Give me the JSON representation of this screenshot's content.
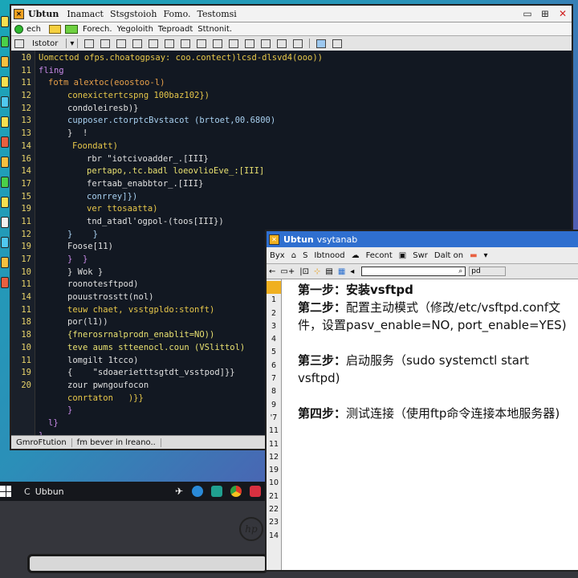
{
  "colors": {
    "code_bg": "#121822",
    "gutter_yellow": "#e8d36a",
    "notepad_title": "#2f6fcf",
    "accent_orange": "#f0b020"
  },
  "editor": {
    "app_name": "Ubtun",
    "title_menus": [
      "Inamact",
      "Stsgstoioh",
      "Fomo.",
      "Testomsi"
    ],
    "menubar": [
      "ech",
      "Forech.",
      "Yegoloith",
      "Teproadt",
      "Sttnonit."
    ],
    "toolbar_label": "Istotor",
    "line_numbers": [
      "10",
      "11",
      "11",
      "12",
      "12",
      "13",
      "13",
      "14",
      "16",
      "14",
      "17",
      "15",
      "19",
      "11",
      "12",
      "19",
      "17",
      "10",
      "11",
      "14",
      "11",
      "18",
      "18",
      "10",
      "11",
      "19",
      "20"
    ],
    "code_lines": [
      {
        "indent": 0,
        "color": "#e8c84a",
        "text": "Uomcctod ofps.choatogpsay: coo.contect)lcsd-dlsvd4(ooo))"
      },
      {
        "indent": 0,
        "color": "#c98ae8",
        "text": "fling"
      },
      {
        "indent": 2,
        "color": "#e8a04a",
        "text": "fotm alextoc(eoostoo-l)"
      },
      {
        "indent": 6,
        "color": "#e8c84a",
        "text": "conexictertcspng 100baz102})"
      },
      {
        "indent": 6,
        "color": "#e0e0e0",
        "text": "condoleiresb)}"
      },
      {
        "indent": 6,
        "color": "#a8d0f0",
        "text": "cupposer.ctorptcBvstacot (brtoet,00.6800)"
      },
      {
        "indent": 6,
        "color": "#e0e0e0",
        "text": "}  !"
      },
      {
        "indent": 7,
        "color": "#e8c84a",
        "text": "Foondatt)"
      },
      {
        "indent": 10,
        "color": "#e0e0e0",
        "text": "rbr \"iotcivoadder_.[III}"
      },
      {
        "indent": 10,
        "color": "#e8e070",
        "text": "pertapo,.tc.badl loeovlioEve_:[III]"
      },
      {
        "indent": 10,
        "color": "#e0e0e0",
        "text": "fertaab_enabbtor_.[III}"
      },
      {
        "indent": 10,
        "color": "#a8d0f0",
        "text": "conrrey]})"
      },
      {
        "indent": 10,
        "color": "#e8c84a",
        "text": "ver ttosaatta)"
      },
      {
        "indent": 10,
        "color": "#e0e0e0",
        "text": "tnd_atadl'ogpol-(toos[III})"
      },
      {
        "indent": 6,
        "color": "#a8d0f0",
        "text": "}    }"
      },
      {
        "indent": 6,
        "color": "#e0e0e0",
        "text": "Foose[11)"
      },
      {
        "indent": 6,
        "color": "#c98ae8",
        "text": "}  }"
      },
      {
        "indent": 6,
        "color": "#e0e0e0",
        "text": "} Wok }"
      },
      {
        "indent": 6,
        "color": "#e0e0e0",
        "text": "roonotesftpod)"
      },
      {
        "indent": 6,
        "color": "#e0e0e0",
        "text": "pouustrosstt(nol)"
      },
      {
        "indent": 6,
        "color": "#e8c84a",
        "text": "teuw chaet, vsstgpldo:stonft)"
      },
      {
        "indent": 6,
        "color": "#e0e0e0",
        "text": "por(l1))"
      },
      {
        "indent": 6,
        "color": "#e8e070",
        "text": "{fnerosrnalprodn_enablit=NO))"
      },
      {
        "indent": 6,
        "color": "#e8e070",
        "text": "teve aums stteenocl.coun (VSlittol)"
      },
      {
        "indent": 6,
        "color": "#e0e0e0",
        "text": "lomgilt 1tcco)"
      },
      {
        "indent": 6,
        "color": "#e0e0e0",
        "text": "{    \"sdoaerietttsgtdt_vsstpod]}}"
      },
      {
        "indent": 6,
        "color": "#e0e0e0",
        "text": "zour pwngoufocon"
      },
      {
        "indent": 6,
        "color": "#e8c84a",
        "text": "conrtaton   )}}"
      },
      {
        "indent": 6,
        "color": "#c98ae8",
        "text": "}"
      },
      {
        "indent": 2,
        "color": "#c98ae8",
        "text": "l}"
      },
      {
        "indent": 0,
        "color": "#c98ae8",
        "text": "}"
      }
    ],
    "status_left": "GmroFtution",
    "status_right": "fm bever in lreano.."
  },
  "taskbar": {
    "app_label": "Ubbun"
  },
  "notepad": {
    "app_name": "Ubtun",
    "title_suffix": "vsytanab",
    "menu": [
      "Byx",
      "S",
      "Ibtnood",
      "Fecont",
      "Swr",
      "Dalt on"
    ],
    "line_numbers": [
      "",
      "1",
      "2",
      "3",
      "4",
      "5",
      "6",
      "7",
      "8",
      "9",
      "'7",
      "11",
      "11",
      "12",
      "19",
      "10",
      "21",
      "22",
      "23",
      "14"
    ],
    "steps": [
      {
        "head": "第一步：安装vsftpd",
        "body": ""
      },
      {
        "head": "第二步：",
        "body": "配置主动模式（修改/etc/vsftpd.conf文件，设置pasv_enable=NO, port_enable=YES)"
      },
      {
        "head": "第三步：",
        "body": "启动服务（sudo systemctl start vsftpd)"
      },
      {
        "head": "第四步：",
        "body": "测试连接（使用ftp命令连接本地服务器)"
      }
    ]
  }
}
